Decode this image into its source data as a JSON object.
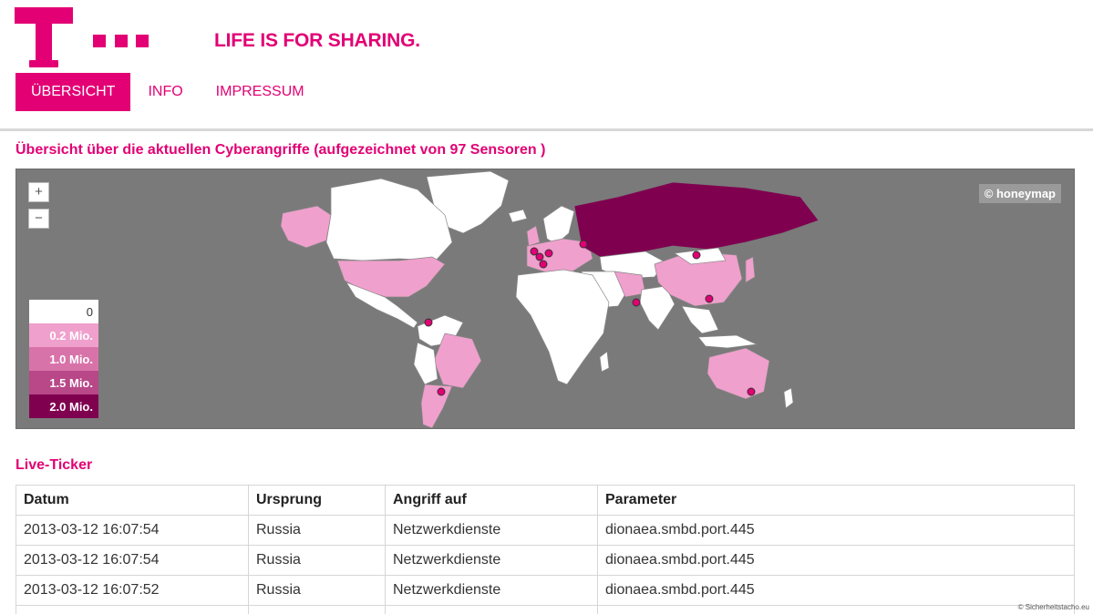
{
  "brand": {
    "tagline": "LIFE IS FOR SHARING.",
    "color": "#e20074"
  },
  "nav": {
    "items": [
      {
        "label": "ÜBERSICHT",
        "active": true
      },
      {
        "label": "INFO",
        "active": false
      },
      {
        "label": "IMPRESSUM",
        "active": false
      }
    ]
  },
  "map_section": {
    "title": "Übersicht über die aktuellen Cyberangriffe (aufgezeichnet von 97 Sensoren )",
    "zoom_in": "+",
    "zoom_out": "−",
    "attribution": "© honeymap",
    "legend": [
      {
        "label": "0",
        "color": "#ffffff"
      },
      {
        "label": "0.2 Mio.",
        "color": "#f0a0cc"
      },
      {
        "label": "1.0 Mio.",
        "color": "#d873aa"
      },
      {
        "label": "1.5 Mio.",
        "color": "#b84888"
      },
      {
        "label": "2.0 Mio.",
        "color": "#800050"
      }
    ]
  },
  "ticker": {
    "title": "Live-Ticker",
    "columns": [
      "Datum",
      "Ursprung",
      "Angriff auf",
      "Parameter"
    ],
    "rows": [
      [
        "2013-03-12 16:07:54",
        "Russia",
        "Netzwerkdienste",
        "dionaea.smbd.port.445"
      ],
      [
        "2013-03-12 16:07:54",
        "Russia",
        "Netzwerkdienste",
        "dionaea.smbd.port.445"
      ],
      [
        "2013-03-12 16:07:52",
        "Russia",
        "Netzwerkdienste",
        "dionaea.smbd.port.445"
      ]
    ]
  },
  "credit": "© Sicherheitstacho.eu"
}
